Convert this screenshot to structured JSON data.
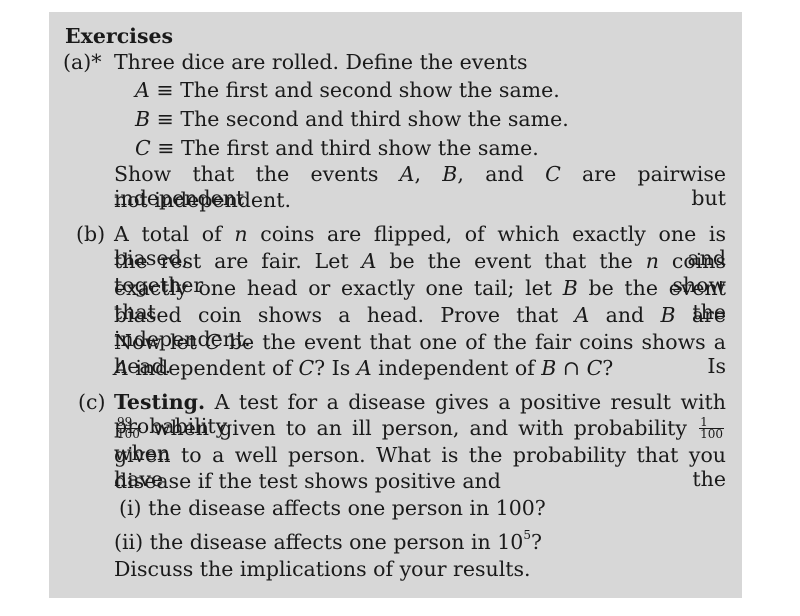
{
  "heading": "Exercises",
  "a": {
    "label": "(a)*",
    "intro": "Three dice are rolled. Define the events",
    "events": [
      {
        "symbol": "A",
        "op": "≡",
        "text": "The first and second show the same."
      },
      {
        "symbol": "B",
        "op": "≡",
        "text": "The second and third show the same."
      },
      {
        "symbol": "C",
        "op": "≡",
        "text": "The first and third show the same."
      }
    ],
    "show_1a": "Show that the events ",
    "show_1b": "A",
    "show_1c": ", ",
    "show_1d": "B",
    "show_1e": ", and ",
    "show_1f": "C",
    "show_1g": " are pairwise independent but",
    "show_2": "not independent."
  },
  "b": {
    "label": "(b)",
    "l1a": "A total of ",
    "l1b": "n",
    "l1c": " coins are flipped, of which exactly one is biased, and",
    "l2a": "the rest are fair. Let ",
    "l2b": "A",
    "l2c": " be the event that the ",
    "l2d": "n",
    "l2e": " coins together show",
    "l3a": "exactly one head or exactly one tail; let ",
    "l3b": "B",
    "l3c": " be the event that the",
    "l4a": "biased coin shows a head. Prove that ",
    "l4b": "A",
    "l4c": " and ",
    "l4d": "B",
    "l4e": " are independent.",
    "l5a": "Now let ",
    "l5b": "C",
    "l5c": " be the event that one of the fair coins shows a head. Is",
    "l6a": "A",
    "l6b": " independent of ",
    "l6c": "C",
    "l6d": "? Is ",
    "l6e": "A",
    "l6f": " independent of ",
    "l6g": "B",
    "l6h": " ∩ ",
    "l6i": "C",
    "l6j": "?"
  },
  "c": {
    "label": "(c)",
    "title": "Testing.",
    "l1": " A test for a disease gives a positive result with probability",
    "frac1_num": "99",
    "frac1_den": "100",
    "l2a": " when given to an ill person, and with probability ",
    "frac2_num": "1",
    "frac2_den": "100",
    "l2b": " when",
    "l3": "given to a well person. What is the probability that you have the",
    "l4": "disease if the test shows positive and",
    "i_label": "(i)",
    "i_text": "the disease affects one person in 100?",
    "ii_label": "(ii)",
    "ii_text_a": "the disease affects one person in 10",
    "ii_sup": "5",
    "ii_text_b": "?",
    "l7": "Discuss the implications of your results."
  }
}
